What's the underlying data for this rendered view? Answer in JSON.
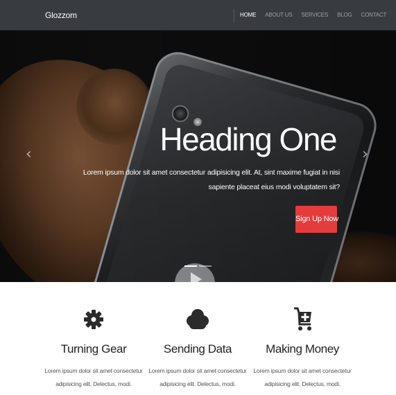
{
  "navbar": {
    "brand": "Glozzom",
    "links": [
      {
        "label": "HOME",
        "active": true
      },
      {
        "label": "ABOUT US",
        "active": false
      },
      {
        "label": "SERVICES",
        "active": false
      },
      {
        "label": "BLOG",
        "active": false
      },
      {
        "label": "CONTACT",
        "active": false
      }
    ]
  },
  "hero": {
    "heading": "Heading One",
    "text": "Lorem ipsum dolor sit amet consectetur adipisicing elit. At, sint maxime fugiat in nisi sapiente placeat eius modi voluptatem sit?",
    "button_label": "Sign Up Now",
    "prev_icon": "chevron-left-icon",
    "next_icon": "chevron-right-icon",
    "slide_count": 2,
    "active_slide": 1
  },
  "features": [
    {
      "icon": "gear-icon",
      "title": "Turning Gear",
      "description": "Lorem ipsum dolor sit amet consectetur adipisicing elit. Delectus, modi."
    },
    {
      "icon": "cloud-icon",
      "title": "Sending Data",
      "description": "Lorem ipsum dolor sit amet consectetur adipisicing elit. Delectus, modi."
    },
    {
      "icon": "cart-plus-icon",
      "title": "Making Money",
      "description": "Lorem ipsum dolor sit amet consectetur adipisicing elit. Delectus, modi."
    }
  ],
  "colors": {
    "navbar": "#383c41",
    "accent": "#e43c3c",
    "icon": "#2b2b2b"
  }
}
